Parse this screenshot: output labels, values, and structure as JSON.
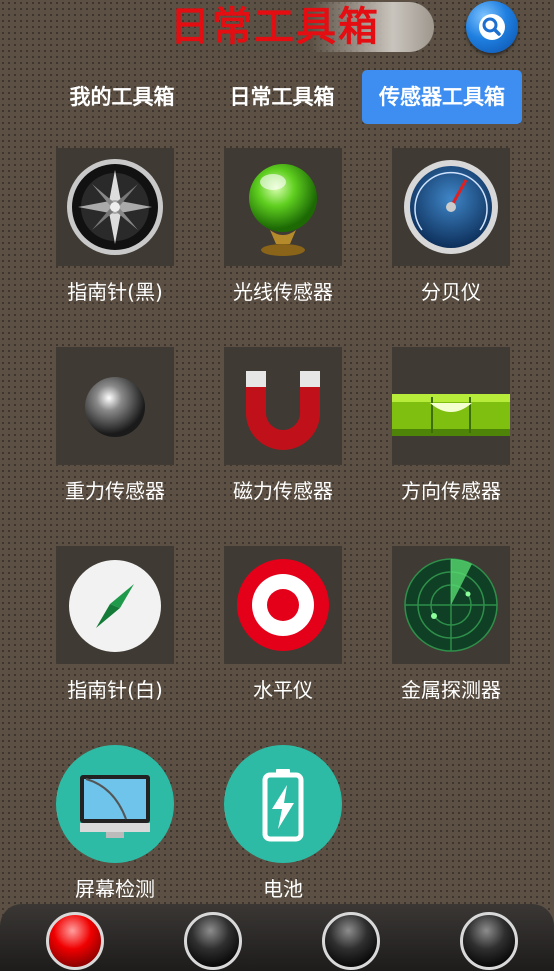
{
  "header": {
    "title": "日常工具箱",
    "search_icon": "search-icon"
  },
  "tabs": [
    {
      "label": "我的工具箱",
      "active": false
    },
    {
      "label": "日常工具箱",
      "active": false
    },
    {
      "label": "传感器工具箱",
      "active": true
    }
  ],
  "tools": [
    {
      "label": "指南针(黑)",
      "icon": "compass-black-icon"
    },
    {
      "label": "光线传感器",
      "icon": "light-sensor-icon"
    },
    {
      "label": "分贝仪",
      "icon": "decibel-meter-icon"
    },
    {
      "label": "重力传感器",
      "icon": "gravity-sensor-icon"
    },
    {
      "label": "磁力传感器",
      "icon": "magnet-icon"
    },
    {
      "label": "方向传感器",
      "icon": "spirit-level-icon"
    },
    {
      "label": "指南针(白)",
      "icon": "compass-white-icon"
    },
    {
      "label": "水平仪",
      "icon": "level-target-icon"
    },
    {
      "label": "金属探测器",
      "icon": "radar-icon"
    },
    {
      "label": "屏幕检测",
      "icon": "screen-test-icon"
    },
    {
      "label": "电池",
      "icon": "battery-icon"
    }
  ],
  "bottom_nav": {
    "active_index": 0,
    "count": 4
  },
  "colors": {
    "title_red": "#e30d12",
    "tab_active": "#3d8ef0",
    "teal": "#2ebba5"
  }
}
